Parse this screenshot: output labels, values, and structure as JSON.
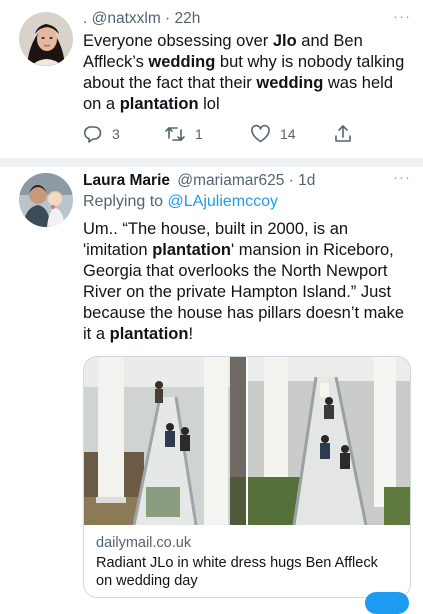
{
  "tweet1": {
    "handle_time": ". @natxxlm · 22h",
    "text": [
      {
        "t": "Everyone obsessing over ",
        "b": false
      },
      {
        "t": "Jlo",
        "b": true
      },
      {
        "t": " and Ben Affleck’s ",
        "b": false
      },
      {
        "t": "wedding",
        "b": true
      },
      {
        "t": " but why is nobody talking about the fact that their ",
        "b": false
      },
      {
        "t": "wedding",
        "b": true
      },
      {
        "t": " was held on a ",
        "b": false
      },
      {
        "t": "plantation",
        "b": true
      },
      {
        "t": " lol",
        "b": false
      }
    ],
    "actions": {
      "reply_count": "3",
      "retweet_count": "1",
      "like_count": "14"
    },
    "more_label": "···"
  },
  "tweet2": {
    "name": "Laura Marie",
    "handle_time": "@mariamar625 · 1d",
    "replying_prefix": "Replying to ",
    "replying_handle": "@LAjuliemccoy",
    "text": [
      {
        "t": "Um.. “The house, built in 2000, is an 'imitation ",
        "b": false
      },
      {
        "t": "plantation",
        "b": true
      },
      {
        "t": "' mansion in Riceboro, Georgia that overlooks the North Newport River on the private Hampton Island.” Just because the house has pillars doesn’t make it a ",
        "b": false
      },
      {
        "t": "plantation",
        "b": true
      },
      {
        "t": "!",
        "b": false
      }
    ],
    "more_label": "···",
    "card": {
      "domain": "dailymail.co.uk",
      "title": "Radiant JLo in white dress hugs Ben Affleck on wedding day"
    }
  },
  "colors": {
    "link": "#1d9bf0",
    "muted": "#536471",
    "text": "#0f1419"
  }
}
